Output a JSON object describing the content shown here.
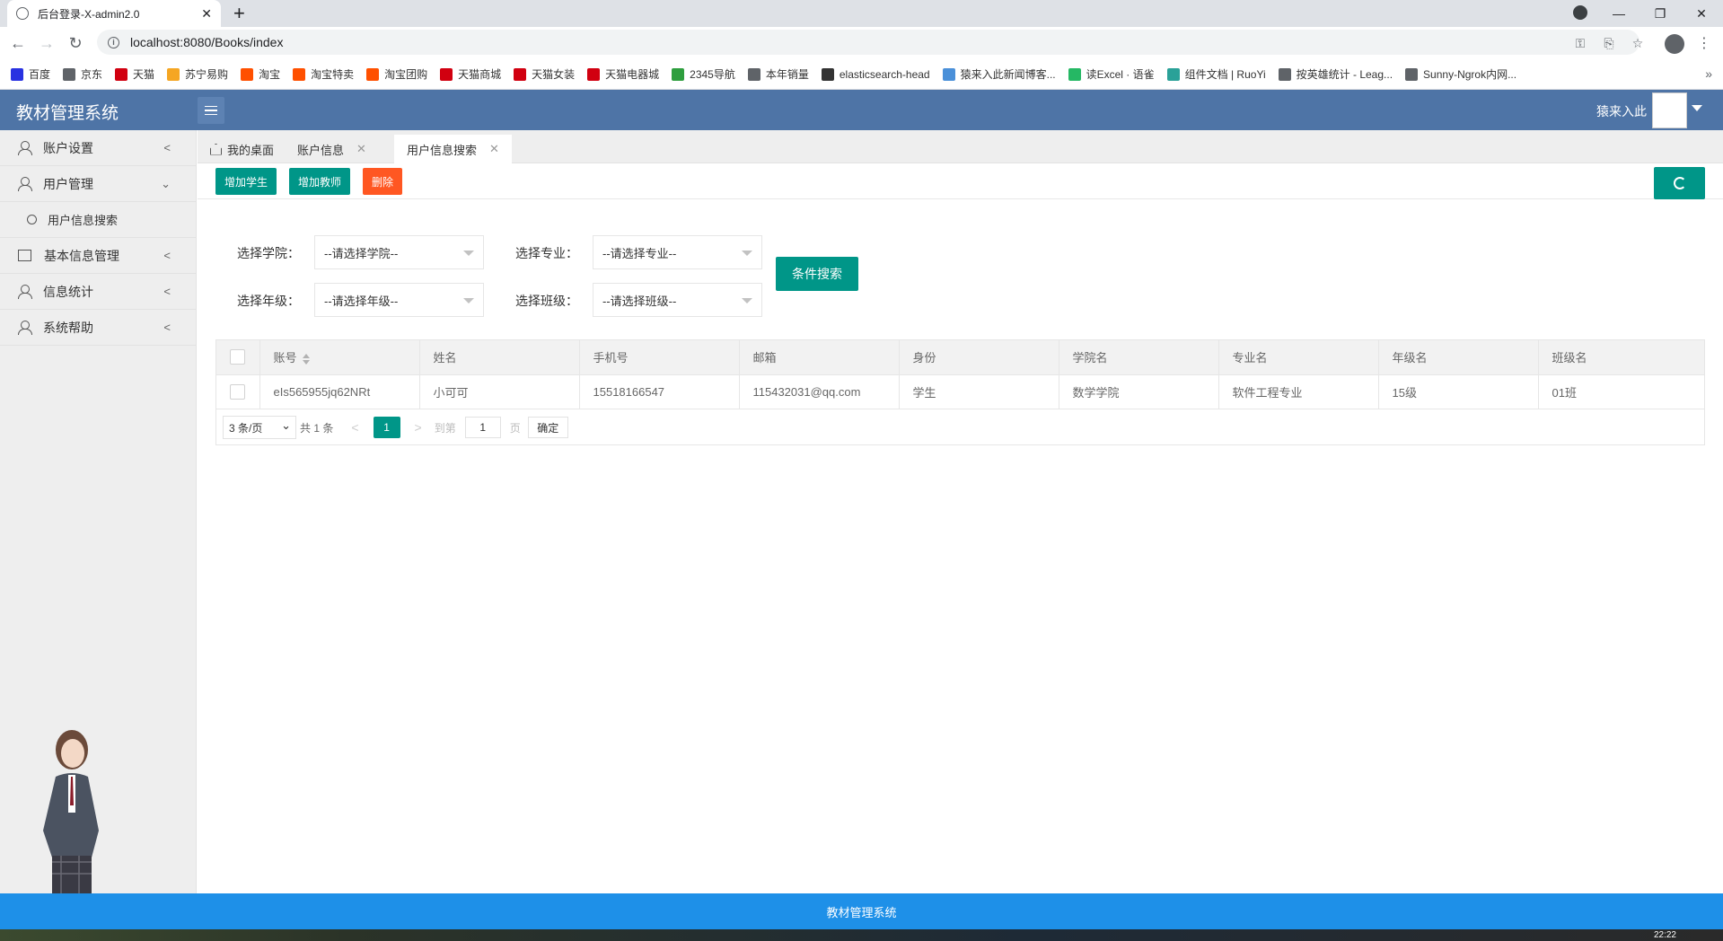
{
  "browser": {
    "tab_title": "后台登录-X-admin2.0",
    "url": "localhost:8080/Books/index",
    "bookmarks": [
      {
        "label": "百度",
        "color": "#2932e1"
      },
      {
        "label": "京东",
        "color": "#5f6368"
      },
      {
        "label": "天猫",
        "color": "#d10010"
      },
      {
        "label": "苏宁易购",
        "color": "#f5a623"
      },
      {
        "label": "淘宝",
        "color": "#ff5000"
      },
      {
        "label": "淘宝特卖",
        "color": "#ff5000"
      },
      {
        "label": "淘宝团购",
        "color": "#ff5000"
      },
      {
        "label": "天猫商城",
        "color": "#d10010"
      },
      {
        "label": "天猫女装",
        "color": "#d10010"
      },
      {
        "label": "天猫电器城",
        "color": "#d10010"
      },
      {
        "label": "2345导航",
        "color": "#2e9e3e"
      },
      {
        "label": "本年销量",
        "color": "#5f6368"
      },
      {
        "label": "elasticsearch-head",
        "color": "#333333"
      },
      {
        "label": "猿来入此新闻博客...",
        "color": "#4a90d9"
      },
      {
        "label": "读Excel · 语雀",
        "color": "#25b864"
      },
      {
        "label": "组件文档 | RuoYi",
        "color": "#2aa198"
      },
      {
        "label": "按英雄统计 - Leag...",
        "color": "#5f6368"
      },
      {
        "label": "Sunny-Ngrok内网...",
        "color": "#5f6368"
      }
    ]
  },
  "app": {
    "title": "教材管理系统",
    "username": "猿来入此"
  },
  "sidebar": {
    "items": [
      {
        "label": "账户设置"
      },
      {
        "label": "用户管理"
      },
      {
        "label": "用户信息搜索"
      },
      {
        "label": "基本信息管理"
      },
      {
        "label": "信息统计"
      },
      {
        "label": "系统帮助"
      }
    ]
  },
  "tabs": [
    {
      "label": "我的桌面"
    },
    {
      "label": "账户信息"
    },
    {
      "label": "用户信息搜索"
    }
  ],
  "toolbar": {
    "add_student": "增加学生",
    "add_teacher": "增加教师",
    "delete": "删除"
  },
  "filters": {
    "college_label": "选择学院：",
    "college_value": "--请选择学院--",
    "major_label": "选择专业：",
    "major_value": "--请选择专业--",
    "grade_label": "选择年级：",
    "grade_value": "--请选择年级--",
    "class_label": "选择班级：",
    "class_value": "--请选择班级--",
    "search_button": "条件搜索"
  },
  "table": {
    "headers": [
      "账号",
      "姓名",
      "手机号",
      "邮箱",
      "身份",
      "学院名",
      "专业名",
      "年级名",
      "班级名"
    ],
    "rows": [
      [
        "eIs565955jq62NRt",
        "小可可",
        "15518166547",
        "115432031@qq.com",
        "学生",
        "数学学院",
        "软件工程专业",
        "15级",
        "01班"
      ]
    ]
  },
  "pager": {
    "per_page": "3 条/页",
    "total": "共 1 条",
    "current": "1",
    "goto_label": "到第",
    "goto_value": "1",
    "page_unit": "页",
    "confirm": "确定"
  },
  "footer": {
    "text": "教材管理系统"
  },
  "taskbar": {
    "clock": "22:22"
  }
}
